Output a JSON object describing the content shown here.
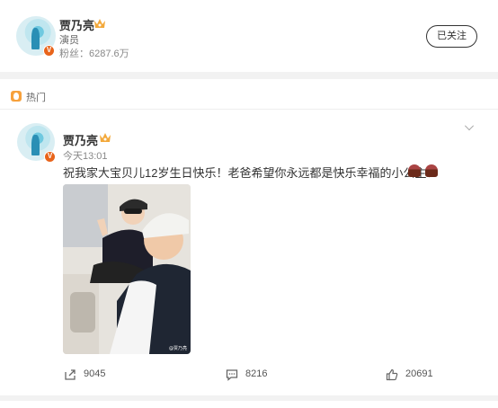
{
  "profile": {
    "name": "贾乃亮",
    "role": "演员",
    "fans": "粉丝：6287.6万",
    "follow_label": "已关注",
    "badge": "V"
  },
  "hot": {
    "label": "热门"
  },
  "post": {
    "author": "贾乃亮",
    "time": "今天13:01",
    "text": "祝我家大宝贝儿12岁生日快乐！老爸希望你永远都是快乐幸福的小公主！",
    "badge": "V"
  },
  "actions": {
    "repost_count": "9045",
    "comment_count": "8216",
    "like_count": "20691"
  },
  "colors": {
    "verified": "#e8641b",
    "hot": "#f7a13c",
    "background": "#f2f2f2"
  }
}
